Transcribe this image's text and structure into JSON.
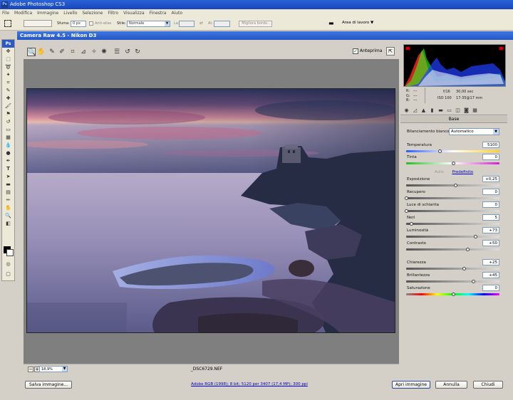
{
  "app": {
    "title": "Adobe Photoshop CS3",
    "ps_badge": "Ps"
  },
  "menu": [
    "File",
    "Modifica",
    "Immagine",
    "Livello",
    "Selezione",
    "Filtro",
    "Visualizza",
    "Finestra",
    "Aiuto"
  ],
  "options": {
    "feather_label": "Sfuma:",
    "feather_value": "0 px",
    "antialias_label": "Anti-alias",
    "style_label": "Stile:",
    "style_value": "Normale",
    "width_label": "La:",
    "height_label": "Al:",
    "refine_edge": "Migliora bordo...",
    "workspace": "Area di lavoro"
  },
  "camera_raw": {
    "title": "Camera Raw 4.5  -  Nikon D3",
    "preview_label": "Anteprima",
    "zoom": "18,9%",
    "filename": "_DSC6729.NEF",
    "save_button": "Salva immagine...",
    "workflow_link": "Adobe RGB (1998); 8 bit; 5120 per 3407 (17,4 MP); 300 ppi",
    "open_button": "Apri immagine",
    "cancel_button": "Annulla",
    "done_button": "Chiudi"
  },
  "readout": {
    "r": "R:",
    "g": "G:",
    "b": "B:",
    "dash": "---",
    "aperture": "f/16",
    "shutter": "30,00 sec",
    "iso": "ISO 100",
    "lens": "17-35@17 mm"
  },
  "panel": {
    "title": "Base",
    "wb_label": "Bilanciamento bianco:",
    "wb_value": "Automatico",
    "auto_link": "Auto",
    "default_link": "Predefinito",
    "sliders": [
      {
        "label": "Temperatura",
        "value": "5100",
        "pos": 0.36
      },
      {
        "label": "Tinta",
        "value": "0",
        "pos": 0.5
      },
      {
        "label": "Esposizione",
        "value": "+0,25",
        "pos": 0.53
      },
      {
        "label": "Recupero",
        "value": "0",
        "pos": 0.0
      },
      {
        "label": "Luce di schiarita",
        "value": "0",
        "pos": 0.0
      },
      {
        "label": "Neri",
        "value": "5",
        "pos": 0.05
      },
      {
        "label": "Luminosità",
        "value": "+73",
        "pos": 0.74
      },
      {
        "label": "Contrasto",
        "value": "+50",
        "pos": 0.66
      },
      {
        "label": "Chiarezza",
        "value": "+25",
        "pos": 0.62
      },
      {
        "label": "Brillantezza",
        "value": "+45",
        "pos": 0.72
      },
      {
        "label": "Saturazione",
        "value": "0",
        "pos": 0.5
      }
    ]
  },
  "colors": {
    "accent": "#2456c4",
    "link": "#0000cc",
    "panel_bg": "#d4d0c8"
  }
}
